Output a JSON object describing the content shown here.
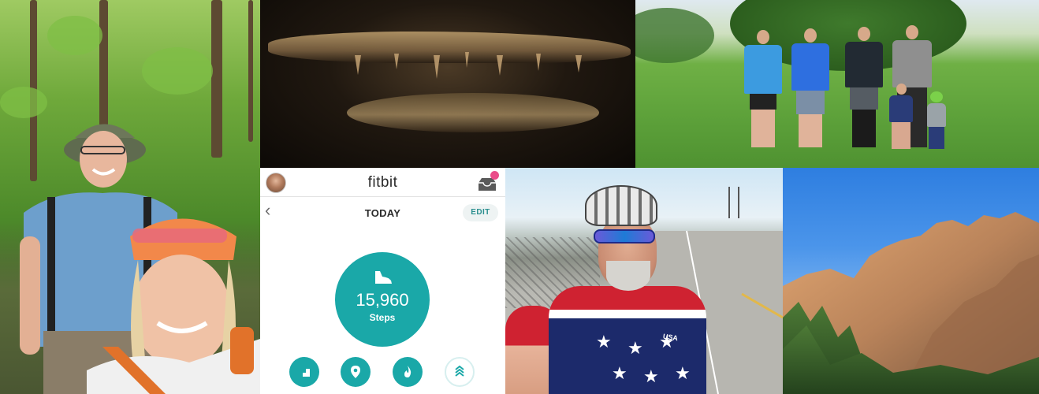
{
  "collage": {
    "tiles": [
      {
        "subject": "forest-hikers"
      },
      {
        "subject": "cave"
      },
      {
        "subject": "park-group"
      },
      {
        "subject": "fitbit-app"
      },
      {
        "subject": "cyclist"
      },
      {
        "subject": "mountains"
      }
    ]
  },
  "fitbit": {
    "logo": "fitbit",
    "title": "TODAY",
    "edit_label": "EDIT",
    "back_glyph": "‹",
    "steps_value": "15,960",
    "steps_label": "Steps",
    "accent_color": "#1aa8a8",
    "notification_color": "#ea4c89",
    "bottom_icons": [
      "floors-icon",
      "location-icon",
      "flame-icon",
      "zone-icon"
    ]
  },
  "cyclist": {
    "jersey_text": "USA"
  }
}
